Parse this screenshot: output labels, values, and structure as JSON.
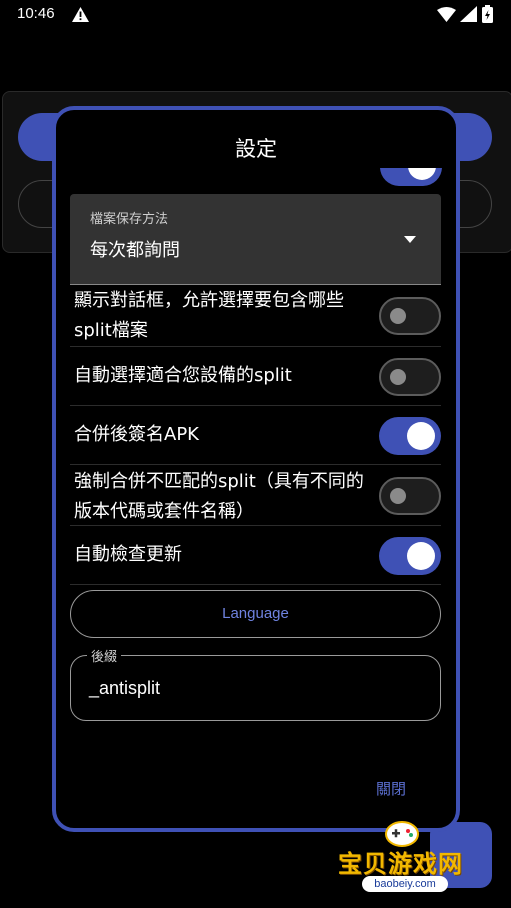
{
  "status_bar": {
    "time": "10:46",
    "icons": [
      "warning-icon",
      "wifi-icon",
      "signal-icon",
      "battery-icon"
    ]
  },
  "dialog": {
    "title": "設定",
    "file_save_method": {
      "label": "檔案保存方法",
      "value": "每次都詢問"
    },
    "settings": [
      {
        "label": "顯示對話框，允許選擇要包含哪些split檔案",
        "enabled": false
      },
      {
        "label": "自動選擇適合您設備的split",
        "enabled": false
      },
      {
        "label": "合併後簽名APK",
        "enabled": true
      },
      {
        "label": "強制合併不匹配的split（具有不同的版本代碼或套件名稱）",
        "enabled": false
      },
      {
        "label": "自動檢查更新",
        "enabled": true
      }
    ],
    "language_button": "Language",
    "suffix": {
      "label": "後綴",
      "value": "_antisplit"
    },
    "close_button": "關閉"
  },
  "watermark": {
    "text": "宝贝游戏网",
    "url": "baobeiy.com"
  },
  "colors": {
    "accent": "#3f51b5",
    "background": "#000000",
    "dropdown_bg": "#333333"
  }
}
